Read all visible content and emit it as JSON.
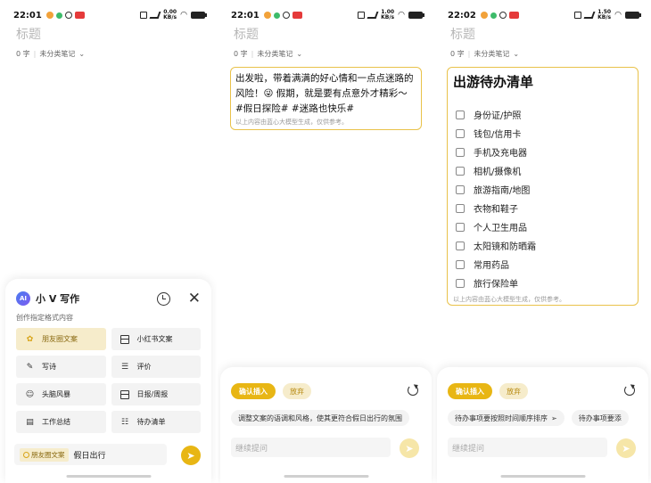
{
  "screens": [
    {
      "status": {
        "time": "22:01",
        "net": [
          "0.00",
          "KB/s"
        ]
      },
      "title": "标题",
      "meta": {
        "count": "0 字",
        "category": "未分类笔记"
      },
      "panel": {
        "name": "小 V 写作",
        "badge": "AI",
        "subtitle": "创作指定格式内容",
        "chips": [
          {
            "label": "朋友圈文案",
            "active": true,
            "icon": "friends-circle-icon"
          },
          {
            "label": "小红书文案",
            "active": false,
            "icon": "note-icon"
          },
          {
            "label": "写诗",
            "active": false,
            "icon": "pen-icon"
          },
          {
            "label": "评价",
            "active": false,
            "icon": "review-icon"
          },
          {
            "label": "头脑风暴",
            "active": false,
            "icon": "brain-icon"
          },
          {
            "label": "日报/周报",
            "active": false,
            "icon": "calendar-icon"
          },
          {
            "label": "工作总结",
            "active": false,
            "icon": "summary-icon"
          },
          {
            "label": "待办清单",
            "active": false,
            "icon": "list-icon"
          }
        ],
        "input_tag": "朋友圈文案",
        "input_value": "假日出行"
      }
    },
    {
      "status": {
        "time": "22:01",
        "net": [
          "1.00",
          "KB/s"
        ]
      },
      "title": "标题",
      "meta": {
        "count": "0 字",
        "category": "未分类笔记"
      },
      "result_text": "出发啦，带着满满的好心情和一点点迷路的风险！😜 假期，就是要有点意外才精彩～ #假日探险# #迷路也快乐#",
      "disclaimer": "以上内容由蓝心大模型生成，仅供参考。",
      "confirm_label": "确认插入",
      "discard_label": "放弃",
      "suggestions": [
        "调整文案的语调和风格，使其更符合假日出行的氛围"
      ],
      "ask_placeholder": "继续提问"
    },
    {
      "status": {
        "time": "22:02",
        "net": [
          "1.50",
          "KB/s"
        ]
      },
      "title": "标题",
      "meta": {
        "count": "0 字",
        "category": "未分类笔记"
      },
      "checklist_title": "出游待办清单",
      "items": [
        "身份证/护照",
        "钱包/信用卡",
        "手机及充电器",
        "相机/摄像机",
        "旅游指南/地图",
        "衣物和鞋子",
        "个人卫生用品",
        "太阳镜和防晒霜",
        "常用药品",
        "旅行保险单"
      ],
      "disclaimer": "以上内容由蓝心大模型生成，仅供参考。",
      "confirm_label": "确认插入",
      "discard_label": "放弃",
      "suggestions": [
        "待办事项要按照时间顺序排序",
        "待办事项要添"
      ],
      "ask_placeholder": "继续提问"
    }
  ],
  "colors": {
    "accent": "#e8b614",
    "chip_active_bg": "#f6eccb",
    "border": "#e9c24a"
  }
}
